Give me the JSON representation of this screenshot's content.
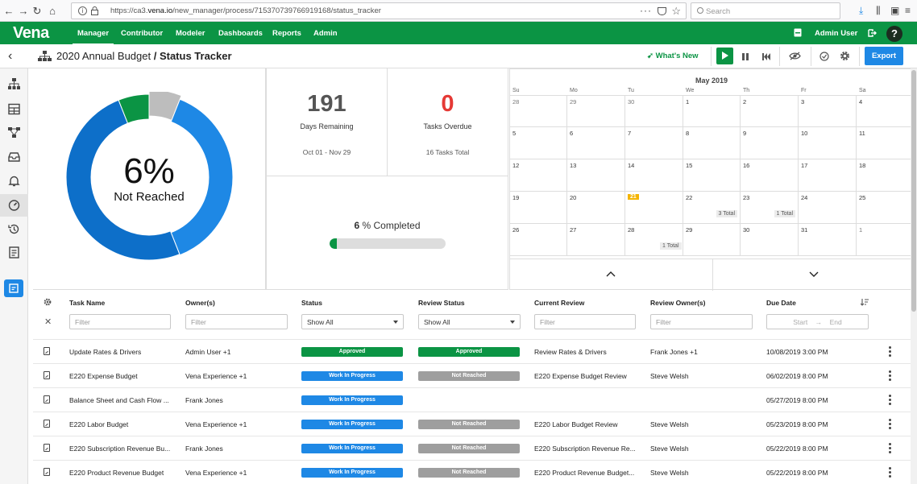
{
  "browser": {
    "url_prefix": "https://ca3.",
    "url_host": "vena.io",
    "url_path": "/new_manager/process/715370739766919168/status_tracker",
    "search_placeholder": "Search"
  },
  "app": {
    "logo": "Vena",
    "nav": [
      {
        "label": "Manager",
        "active": true
      },
      {
        "label": "Contributor"
      },
      {
        "label": "Modeler"
      },
      {
        "label": "Dashboards"
      },
      {
        "label": "Reports"
      },
      {
        "label": "Admin"
      }
    ],
    "user": "Admin User",
    "help": "?"
  },
  "toolbar": {
    "breadcrumb_parent": "2020 Annual Budget",
    "breadcrumb_sep": " / ",
    "breadcrumb_current": "Status Tracker",
    "whats_new": "What's New",
    "export": "Export"
  },
  "donut": {
    "percent_label": "6%",
    "status_label": "Not Reached",
    "segments_pct": {
      "approved": 6,
      "not_reached_gray": 6,
      "in_progress_light": 38,
      "in_progress_dark": 50
    },
    "colors": {
      "approved": "#0b9444",
      "gray": "#bdbdbd",
      "light_blue": "#1e88e5",
      "dark_blue": "#0d6fc9"
    }
  },
  "stats": {
    "days_remaining": "191",
    "days_remaining_label": "Days Remaining",
    "date_range": "Oct 01 - Nov 29",
    "tasks_overdue": "0",
    "tasks_overdue_label": "Tasks Overdue",
    "tasks_total": "16 Tasks Total",
    "completed_number": "6",
    "completed_label": "% Completed",
    "completed_fraction": 0.06
  },
  "calendar": {
    "title": "May 2019",
    "days_of_week": [
      "Su",
      "Mo",
      "Tu",
      "We",
      "Th",
      "Fr",
      "Sa"
    ],
    "weeks": [
      [
        "28",
        "29",
        "30",
        "1",
        "2",
        "3",
        "4"
      ],
      [
        "5",
        "6",
        "7",
        "8",
        "9",
        "10",
        "11"
      ],
      [
        "12",
        "13",
        "14",
        "15",
        "16",
        "17",
        "18"
      ],
      [
        "19",
        "20",
        "21",
        "22",
        "23",
        "24",
        "25"
      ],
      [
        "26",
        "27",
        "28",
        "29",
        "30",
        "31",
        "1"
      ]
    ],
    "badges": {
      "22": "3 Total",
      "23": "1 Total",
      "28b": "1 Total"
    },
    "today": "21"
  },
  "table": {
    "headers": {
      "task_name": "Task Name",
      "owners": "Owner(s)",
      "status": "Status",
      "review_status": "Review Status",
      "current_review": "Current Review",
      "review_owners": "Review Owner(s)",
      "due_date": "Due Date"
    },
    "filters": {
      "placeholder": "Filter",
      "status_value": "Show All",
      "review_status_value": "Show All",
      "due_start": "Start",
      "due_sep": "→",
      "due_end": "End"
    },
    "rows": [
      {
        "task": "Update Rates & Drivers",
        "owners": "Admin User +1",
        "status": "Approved",
        "review_status": "Approved",
        "current_review": "Review Rates & Drivers",
        "review_owners": "Frank Jones +1",
        "due": "10/08/2019 3:00 PM"
      },
      {
        "task": "E220 Expense Budget",
        "owners": "Vena Experience +1",
        "status": "Work In Progress",
        "review_status": "Not Reached",
        "current_review": "E220 Expense Budget Review",
        "review_owners": "Steve Welsh",
        "due": "06/02/2019 8:00 PM"
      },
      {
        "task": "Balance Sheet and Cash Flow ...",
        "owners": "Frank Jones",
        "status": "Work In Progress",
        "review_status": "",
        "current_review": "",
        "review_owners": "",
        "due": "05/27/2019 8:00 PM"
      },
      {
        "task": "E220 Labor Budget",
        "owners": "Vena Experience +1",
        "status": "Work In Progress",
        "review_status": "Not Reached",
        "current_review": "E220 Labor Budget Review",
        "review_owners": "Steve Welsh",
        "due": "05/23/2019 8:00 PM"
      },
      {
        "task": "E220 Subscription Revenue Bu...",
        "owners": "Frank Jones",
        "status": "Work In Progress",
        "review_status": "Not Reached",
        "current_review": "E220 Subscription Revenue Re...",
        "review_owners": "Steve Welsh",
        "due": "05/22/2019 8:00 PM"
      },
      {
        "task": "E220 Product Revenue Budget",
        "owners": "Vena Experience +1",
        "status": "Work In Progress",
        "review_status": "Not Reached",
        "current_review": "E220 Product Revenue Budget...",
        "review_owners": "Steve Welsh",
        "due": "05/22/2019 8:00 PM"
      }
    ],
    "pill_colors": {
      "Approved": "#0b9444",
      "Work In Progress": "#1e88e5",
      "Not Reached": "#9e9e9e"
    }
  }
}
